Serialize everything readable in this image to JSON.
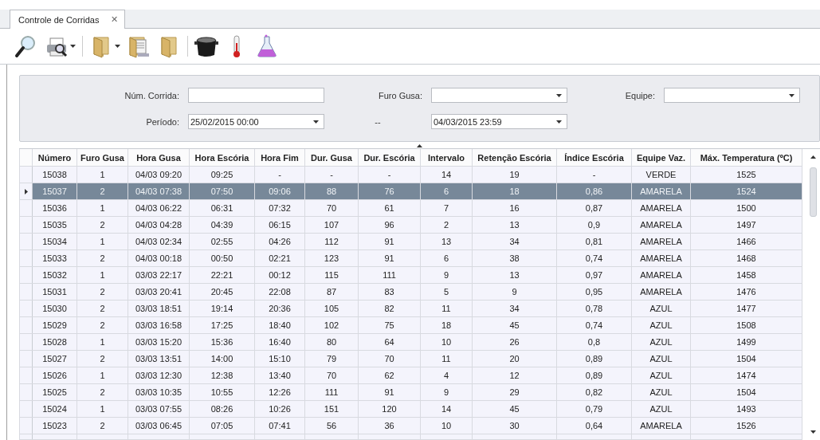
{
  "tabs": [
    {
      "label": "Controle de Corridas",
      "selected": true,
      "close": "✕"
    }
  ],
  "toolbar": [
    {
      "kind": "magnifier",
      "menu": false
    },
    {
      "kind": "printer",
      "menu": true
    },
    {
      "kind": "separator"
    },
    {
      "kind": "folder",
      "menu": true
    },
    {
      "kind": "folder-docs",
      "menu": false
    },
    {
      "kind": "folder",
      "menu": false
    },
    {
      "kind": "separator"
    },
    {
      "kind": "pot",
      "menu": false
    },
    {
      "kind": "thermometer",
      "menu": false
    },
    {
      "kind": "flask",
      "menu": false
    }
  ],
  "filters": [
    [
      {
        "kind": "label",
        "text": "Núm. Corrida:"
      },
      {
        "kind": "text"
      },
      {
        "kind": "label",
        "text": "Furo Gusa:"
      },
      {
        "kind": "combo"
      },
      {
        "kind": "label",
        "text": "Equipe:"
      },
      {
        "kind": "combo"
      }
    ],
    [
      {
        "kind": "label",
        "text": "Período:"
      },
      {
        "kind": "combo",
        "value": "25/02/2015 00:00"
      },
      {
        "kind": "separator",
        "text": "--"
      },
      {
        "kind": "combo",
        "value": "04/03/2015 23:59"
      }
    ]
  ],
  "table": {
    "columns": [
      "Número",
      "Furo Gusa",
      "Hora Gusa",
      "Hora Escória",
      "Hora Fim",
      "Dur. Gusa",
      "Dur. Escória",
      "Intervalo",
      "Retenção Escória",
      "Índice Escória",
      "Equipe Vaz.",
      "Máx. Temperatura (ºC)"
    ],
    "rows": [
      {
        "selected": false,
        "cells": [
          "15038",
          "1",
          "04/03 09:20",
          "09:25",
          "-",
          "-",
          "-",
          "14",
          "19",
          "-",
          "VERDE",
          "1525"
        ]
      },
      {
        "selected": true,
        "cells": [
          "15037",
          "2",
          "04/03 07:38",
          "07:50",
          "09:06",
          "88",
          "76",
          "6",
          "18",
          "0,86",
          "AMARELA",
          "1524"
        ]
      },
      {
        "selected": false,
        "cells": [
          "15036",
          "1",
          "04/03 06:22",
          "06:31",
          "07:32",
          "70",
          "61",
          "7",
          "16",
          "0,87",
          "AMARELA",
          "1500"
        ]
      },
      {
        "selected": false,
        "cells": [
          "15035",
          "2",
          "04/03 04:28",
          "04:39",
          "06:15",
          "107",
          "96",
          "2",
          "13",
          "0,9",
          "AMARELA",
          "1497"
        ]
      },
      {
        "selected": false,
        "cells": [
          "15034",
          "1",
          "04/03 02:34",
          "02:55",
          "04:26",
          "112",
          "91",
          "13",
          "34",
          "0,81",
          "AMARELA",
          "1466"
        ]
      },
      {
        "selected": false,
        "cells": [
          "15033",
          "2",
          "04/03 00:18",
          "00:50",
          "02:21",
          "123",
          "91",
          "6",
          "38",
          "0,74",
          "AMARELA",
          "1468"
        ]
      },
      {
        "selected": false,
        "cells": [
          "15032",
          "1",
          "03/03 22:17",
          "22:21",
          "00:12",
          "115",
          "111",
          "9",
          "13",
          "0,97",
          "AMARELA",
          "1458"
        ]
      },
      {
        "selected": false,
        "cells": [
          "15031",
          "2",
          "03/03 20:41",
          "20:45",
          "22:08",
          "87",
          "83",
          "5",
          "9",
          "0,95",
          "AMARELA",
          "1476"
        ]
      },
      {
        "selected": false,
        "cells": [
          "15030",
          "2",
          "03/03 18:51",
          "19:14",
          "20:36",
          "105",
          "82",
          "11",
          "34",
          "0,78",
          "AZUL",
          "1477"
        ]
      },
      {
        "selected": false,
        "cells": [
          "15029",
          "2",
          "03/03 16:58",
          "17:25",
          "18:40",
          "102",
          "75",
          "18",
          "45",
          "0,74",
          "AZUL",
          "1508"
        ]
      },
      {
        "selected": false,
        "cells": [
          "15028",
          "1",
          "03/03 15:20",
          "15:36",
          "16:40",
          "80",
          "64",
          "10",
          "26",
          "0,8",
          "AZUL",
          "1499"
        ]
      },
      {
        "selected": false,
        "cells": [
          "15027",
          "2",
          "03/03 13:51",
          "14:00",
          "15:10",
          "79",
          "70",
          "11",
          "20",
          "0,89",
          "AZUL",
          "1504"
        ]
      },
      {
        "selected": false,
        "cells": [
          "15026",
          "1",
          "03/03 12:30",
          "12:38",
          "13:40",
          "70",
          "62",
          "4",
          "12",
          "0,89",
          "AZUL",
          "1474"
        ]
      },
      {
        "selected": false,
        "cells": [
          "15025",
          "2",
          "03/03 10:35",
          "10:55",
          "12:26",
          "111",
          "91",
          "9",
          "29",
          "0,82",
          "AZUL",
          "1504"
        ]
      },
      {
        "selected": false,
        "cells": [
          "15024",
          "1",
          "03/03 07:55",
          "08:26",
          "10:26",
          "151",
          "120",
          "14",
          "45",
          "0,79",
          "AZUL",
          "1493"
        ]
      },
      {
        "selected": false,
        "cells": [
          "15023",
          "2",
          "03/03 06:45",
          "07:05",
          "07:41",
          "56",
          "36",
          "10",
          "30",
          "0,64",
          "AMARELA",
          "1526"
        ]
      }
    ]
  }
}
